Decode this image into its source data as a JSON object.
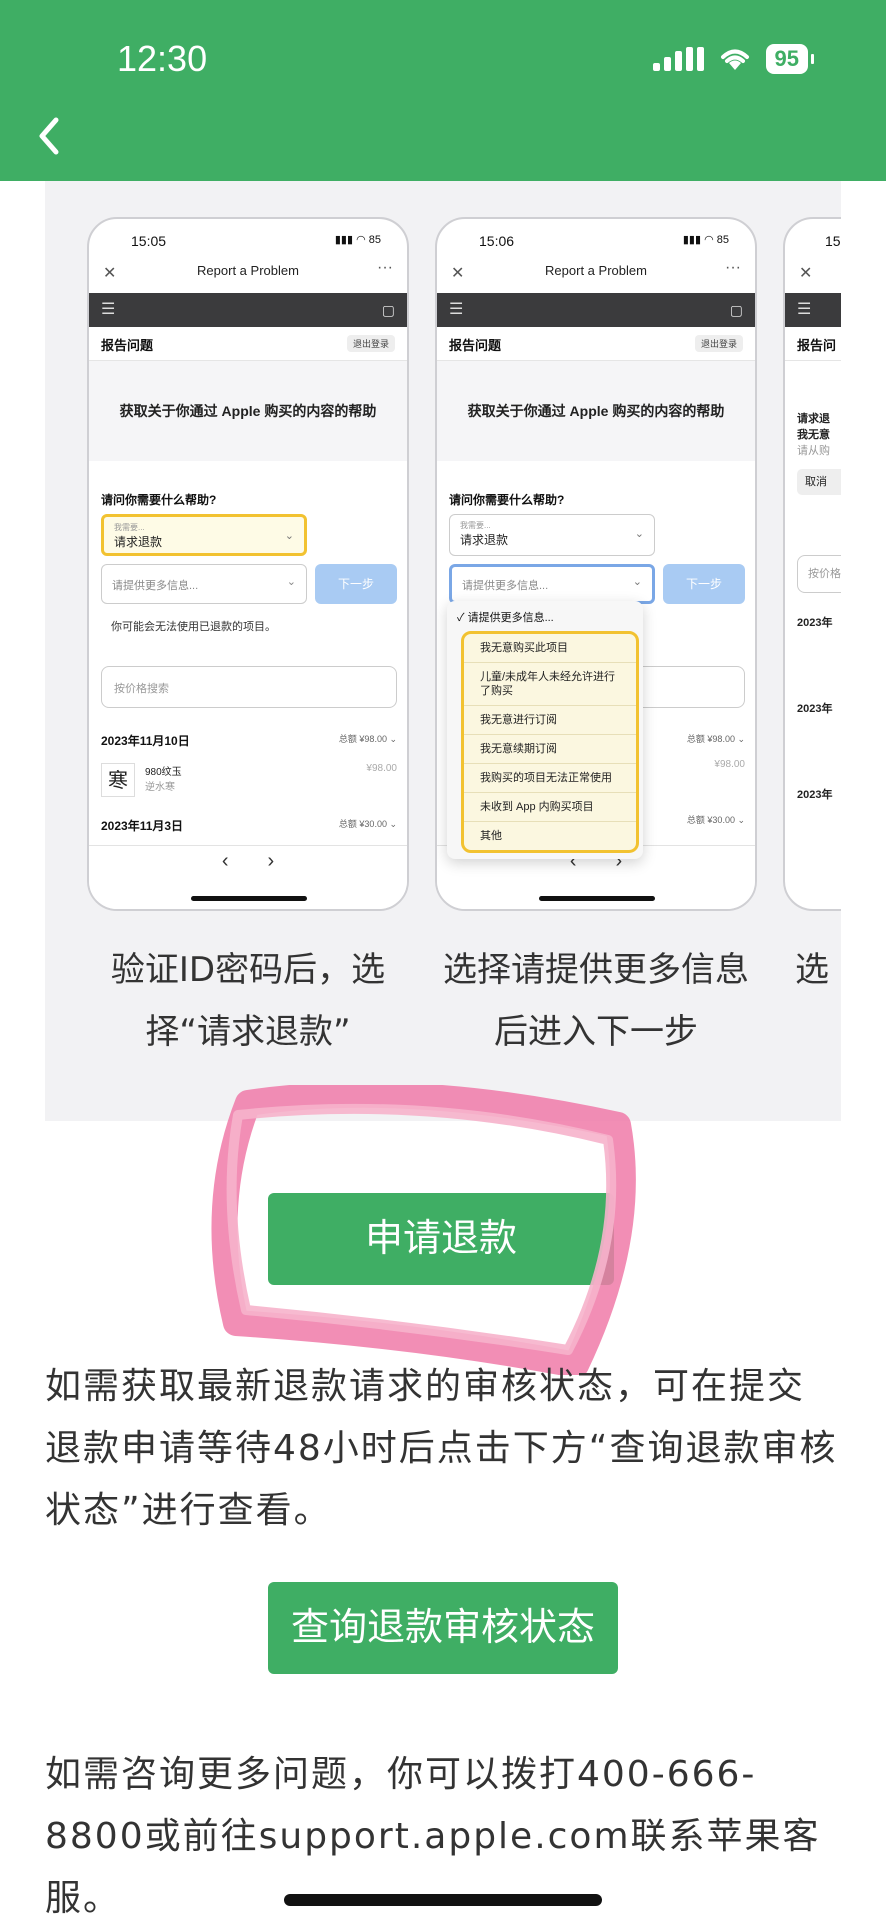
{
  "status_bar": {
    "time": "12:30",
    "battery": "95"
  },
  "screens": [
    {
      "time": "15:05",
      "battery": "85",
      "title": "Report a Problem",
      "header": "报告问题",
      "logout": "退出登录",
      "banner": "获取关于你通过 Apple 购买的内容的帮助",
      "question": "请问你需要什么帮助?",
      "select_small": "我需要...",
      "select_value": "请求退款",
      "more_info": "请提供更多信息...",
      "next": "下一步",
      "note": "你可能会无法使用已退款的项目。",
      "search": "按价格搜索",
      "date1": "2023年11月10日",
      "total1": "总额 ¥98.00 ⌄",
      "item_name": "980纹玉",
      "item_dev": "逆水寒",
      "item_price": "¥98.00",
      "item_art": "寒",
      "date2": "2023年11月3日",
      "total2": "总额 ¥30.00 ⌄",
      "caption": "验证ID密码后，选择“请求退款”"
    },
    {
      "time": "15:06",
      "battery": "85",
      "title": "Report a Problem",
      "header": "报告问题",
      "logout": "退出登录",
      "banner": "获取关于你通过 Apple 购买的内容的帮助",
      "question": "请问你需要什么帮助?",
      "select_small": "我需要...",
      "select_value": "请求退款",
      "more_info": "请提供更多信息...",
      "next": "下一步",
      "dropdown_checked": "✓ 请提供更多信息...",
      "dropdown": [
        "我无意购买此项目",
        "儿童/未成年人未经允许进行了购买",
        "我无意进行订阅",
        "我无意续期订阅",
        "我购买的项目无法正常使用",
        "未收到 App 内购买项目",
        "其他"
      ],
      "total1": "总额 ¥98.00 ⌄",
      "item_price": "¥98.00",
      "total2": "总额 ¥30.00 ⌄",
      "caption": "选择请提供更多信息后进入下一步"
    },
    {
      "time": "15",
      "header": "报告问",
      "line1": "请求退",
      "line2": "我无意",
      "line3": "请从购",
      "cancel": "取消",
      "search": "按价格",
      "date1": "2023年",
      "date2": "2023年",
      "date3": "2023年",
      "caption": "选"
    }
  ],
  "apply_button": "申请退款",
  "paragraph1": "如需获取最新退款请求的审核状态，可在提交退款申请等待48小时后点击下方“查询退款审核状态”进行查看。",
  "query_button": "查询退款审核状态",
  "paragraph2": "如需咨询更多问题，你可以拨打400-666-8800或前往support.apple.com联系苹果客服。",
  "colors": {
    "brand_green": "#3fae64",
    "highlight_yellow": "#f2c230",
    "scribble_pink": "#f07aa8"
  }
}
